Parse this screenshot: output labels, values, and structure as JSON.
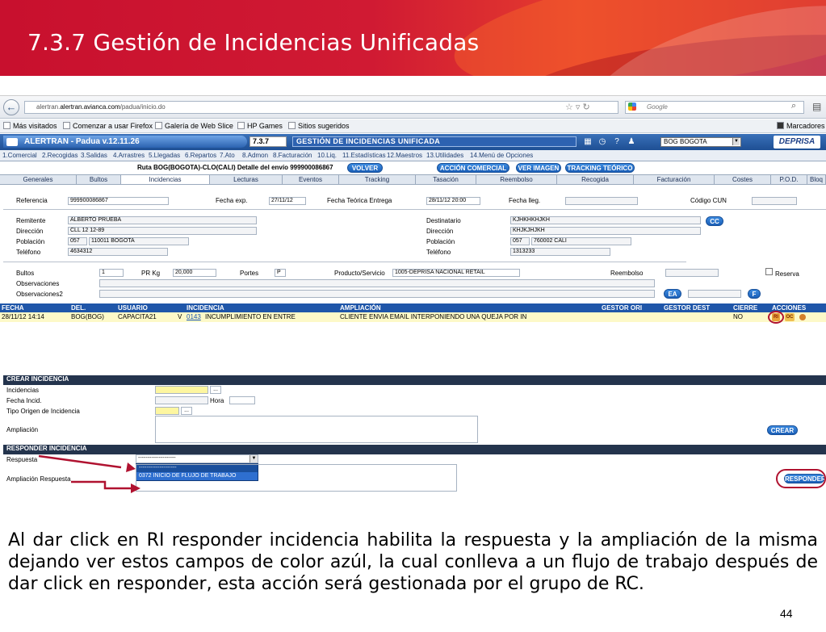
{
  "slide": {
    "title": "7.3.7 Gestión de Incidencias Unificadas",
    "paragraph": "Al dar click en RI responder incidencia habilita la respuesta y la ampliación de la misma dejando ver estos campos de color azúl, la cual conlleva a un flujo de trabajo después de dar click en responder, esta acción será gestionada por el grupo de RC.",
    "page_number": "44"
  },
  "browser": {
    "url_host": "alertran.avianca.com",
    "url_path": "/padua/inicio.do",
    "url_prefix": "alertran.",
    "search_placeholder": "Google",
    "bookmarks": [
      "Más visitados",
      "Comenzar a usar Firefox",
      "Galería de Web Slice",
      "HP Games",
      "Sitios sugeridos"
    ],
    "bookmarks_menu": "Marcadores"
  },
  "app": {
    "title": "ALERTRAN - Padua  v.12.11.26",
    "screen_code": "7.3.7",
    "screen_name": "GESTIÓN DE INCIDENCIAS UNIFICADA",
    "office": "BOG BOGOTA",
    "logo": "DEPRISA",
    "menu": [
      "1.Comercial",
      "2.Recogidas",
      "3.Salidas",
      "4.Arrastres",
      "5.Llegadas",
      "6.Repartos",
      "7.Ato",
      "8.Admon",
      "8.Facturación",
      "10.Liq.",
      "11.Estadísticas",
      "12.Maestros",
      "13.Utilidades",
      "14.Menú de Opciones"
    ]
  },
  "route": {
    "label": "Ruta BOG(BOGOTA)-CLO(CALI)  Detalle del envío 999900086867",
    "volver": "VOLVER",
    "accion_comercial": "ACCIÓN COMERCIAL",
    "ver_imagen": "VER IMAGEN",
    "tracking_teorico": "TRACKING TEÓRICO"
  },
  "tabs": [
    "Generales",
    "Bultos",
    "Incidencias",
    "Lecturas",
    "Eventos",
    "Tracking",
    "Tasación",
    "Reembolso",
    "Recogida",
    "Facturación",
    "Costes",
    "P.O.D.",
    "Bloq"
  ],
  "active_tab": "Incidencias",
  "form": {
    "referencia_lbl": "Referencia",
    "referencia": "999900086867",
    "fecha_exp_lbl": "Fecha exp.",
    "fecha_exp": "27/11/12",
    "fecha_teorica_lbl": "Fecha Teórica Entrega",
    "fecha_teorica": "28/11/12 20:00",
    "fecha_lleg_lbl": "Fecha lleg.",
    "codigo_cun_lbl": "Código CUN",
    "remitente_lbl": "Remitente",
    "remitente": "ALBERTO PRUEBA",
    "direccion_lbl": "Dirección",
    "direccion_rem": "CLL 12 12-89",
    "poblacion_lbl": "Población",
    "poblacion_rem_code": "057",
    "poblacion_rem": "110011 BOGOTA",
    "telefono_lbl": "Teléfono",
    "telefono_rem": "4634312",
    "destinatario_lbl": "Destinatario",
    "destinatario": "KJHKHKHJKH",
    "direccion_des": "KHJKJHJKH",
    "poblacion_des_code": "057",
    "poblacion_des": "760002 CALI",
    "telefono_des": "1313233",
    "cc_btn": "CC",
    "bultos_lbl": "Bultos",
    "bultos": "1",
    "pr_kg_lbl": "PR Kg",
    "pr_kg": "20,000",
    "portes_lbl": "Portes",
    "portes": "P",
    "producto_lbl": "Producto/Servicio",
    "producto": "1005-DEPRISA NACIONAL RETAIL",
    "reembolso_lbl": "Reembolso",
    "reserva_lbl": "Reserva",
    "observaciones_lbl": "Observaciones",
    "observaciones2_lbl": "Observaciones2",
    "ea_btn": "EA",
    "f_btn": "F"
  },
  "grid": {
    "headers": [
      "FECHA",
      "DEL.",
      "USUARIO",
      "INCIDENCIA",
      "AMPLIACIÓN",
      "GESTOR ORI",
      "GESTOR DEST",
      "CIERRE",
      "ACCIONES"
    ],
    "row": {
      "fecha": "28/11/12 14:14",
      "del": "BOG(BOG)",
      "usuario": "CAPACITA21",
      "v": "V",
      "codigo": "0143",
      "incidencia": "INCUMPLIMIENTO EN ENTRE",
      "ampliacion": "CLIENTE ENVIA EMAIL INTERPONIENDO UNA QUEJA POR IN",
      "cierre": "NO",
      "accion_ri": "RI",
      "accion_oc": "OC"
    }
  },
  "crear": {
    "section": "CREAR INCIDENCIA",
    "incidencias_lbl": "Incidencias",
    "fecha_incid_lbl": "Fecha Incid.",
    "hora_lbl": "Hora",
    "tipo_origen_lbl": "Tipo Origen de Incidencia",
    "ampliacion_lbl": "Ampliación",
    "crear_btn": "CREAR",
    "dots": "..."
  },
  "responder": {
    "section": "RESPONDER INCIDENCIA",
    "respuesta_lbl": "Respuesta",
    "respuesta_value": "--------------------",
    "option_blank": "--------------------",
    "option_selected": "0372 INICIO DE FLUJO DE TRABAJO",
    "ampliacion_resp_lbl": "Ampliación Respuesta",
    "responder_btn": "RESPONDER"
  },
  "colors": {
    "banner": "#c8102e",
    "app_blue": "#1f56a9",
    "highlight_row": "#fdf9c8",
    "annotation": "#b01230"
  }
}
